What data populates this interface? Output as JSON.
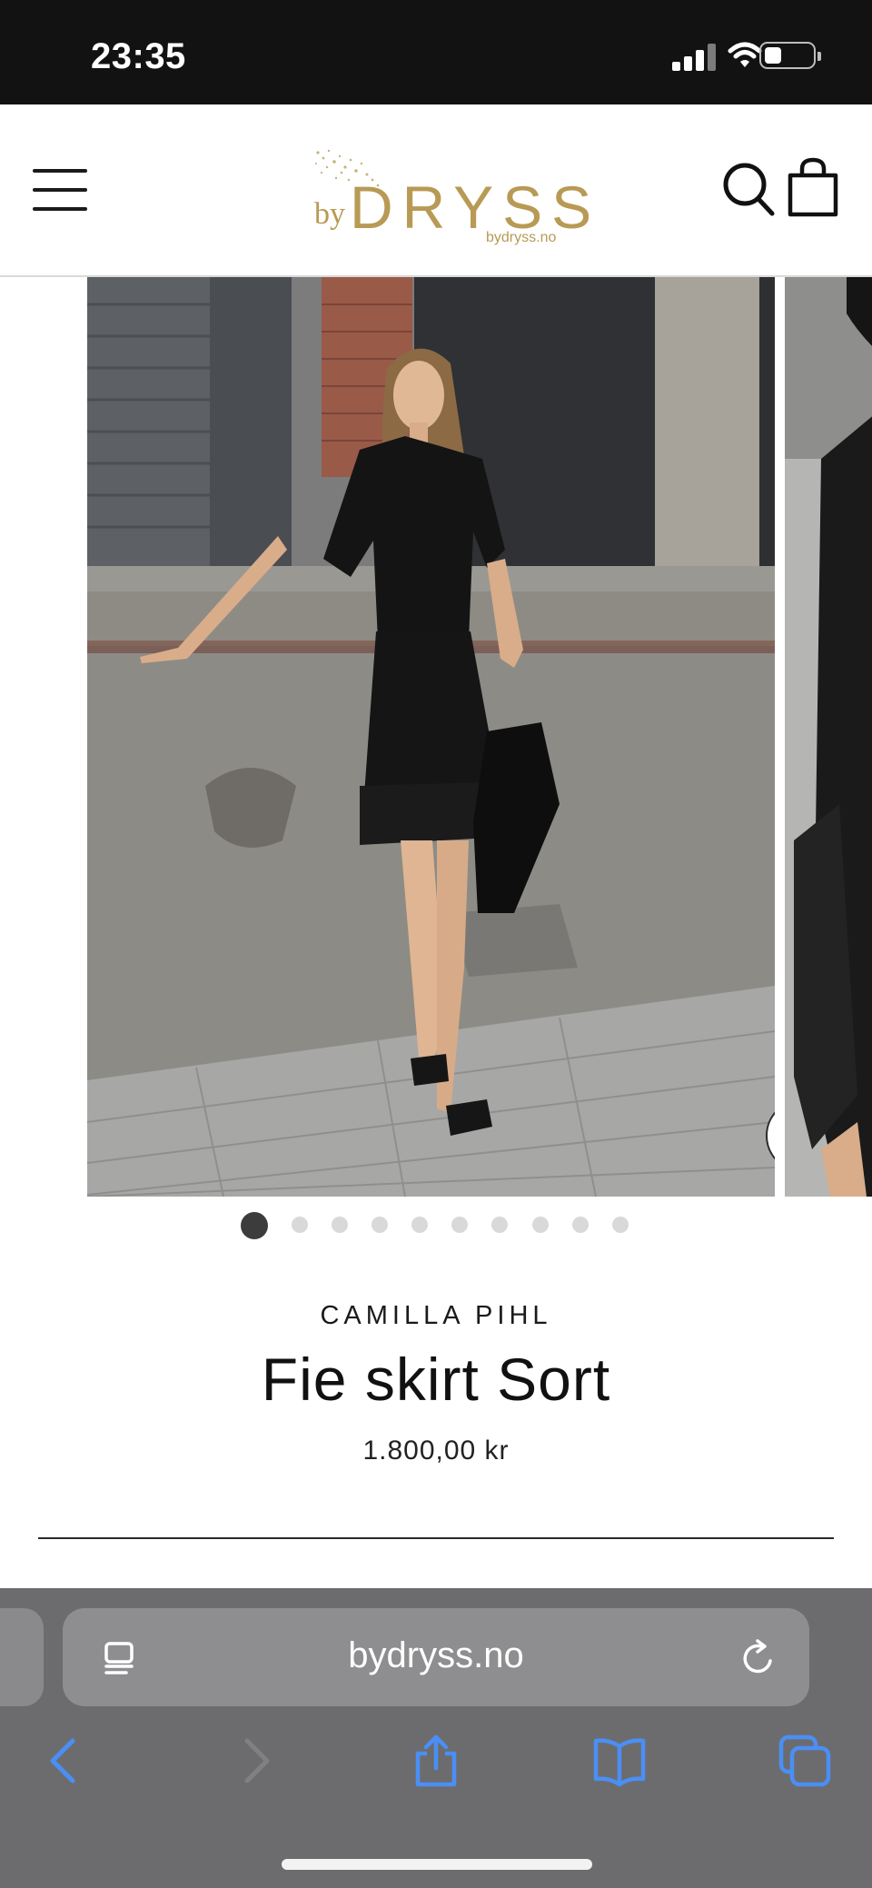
{
  "status_bar": {
    "time": "23:35"
  },
  "header": {
    "logo": {
      "by": "by",
      "word": "DRYSS",
      "sub": "bydryss.no"
    },
    "brand_color": "#b89a55"
  },
  "gallery": {
    "total_images": 10,
    "active_index": 0
  },
  "product": {
    "brand": "CAMILLA PIHL",
    "title": "Fie skirt Sort",
    "price": "1.800,00 kr"
  },
  "browser": {
    "url": "bydryss.no",
    "accent_color": "#4a8ff5"
  }
}
